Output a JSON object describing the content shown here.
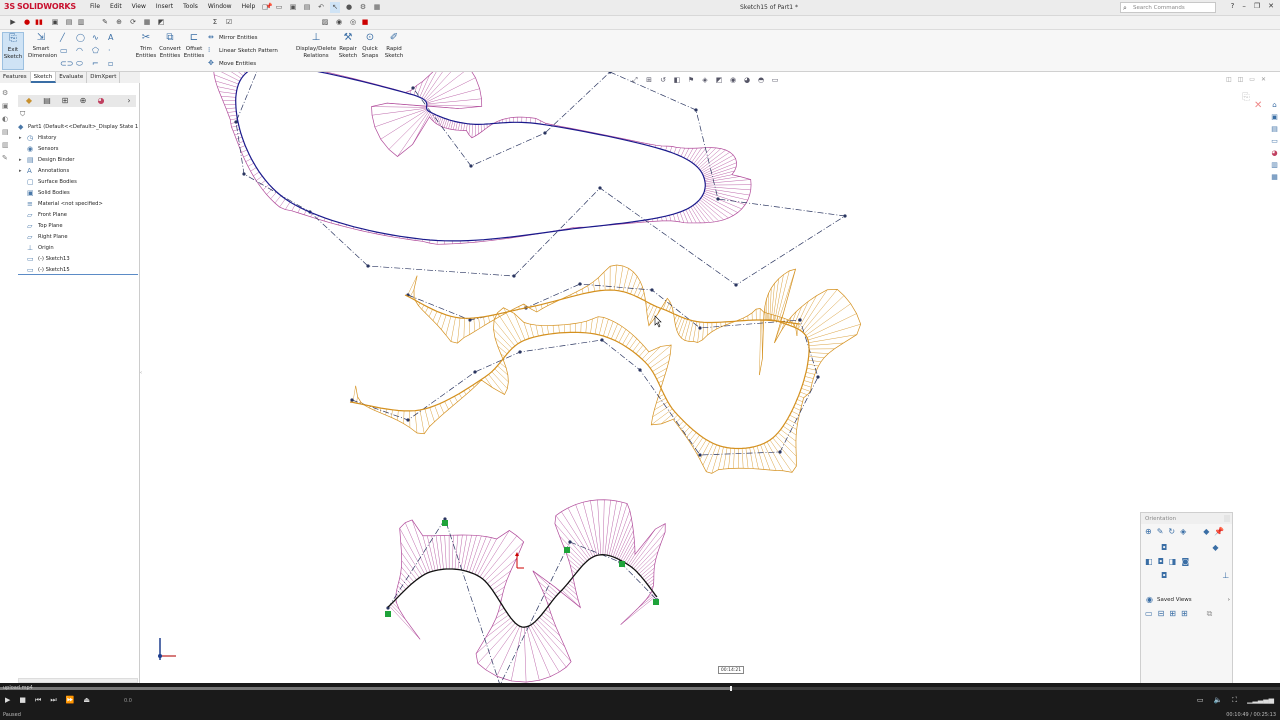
{
  "app": {
    "logo_text": "SOLIDWORKS",
    "document_title": "Sketch15 of Part1 *"
  },
  "menu": [
    "File",
    "Edit",
    "View",
    "Insert",
    "Tools",
    "Window",
    "Help"
  ],
  "search": {
    "placeholder": "Search Commands"
  },
  "ribbon": {
    "exit_sketch": "Exit Sketch",
    "smart_dimension": "Smart Dimension",
    "trim_entities": "Trim Entities",
    "convert_entities": "Convert Entities",
    "offset_entities": "Offset Entities",
    "mirror_entities": "Mirror Entities",
    "linear_sketch_pattern": "Linear Sketch Pattern",
    "move_entities": "Move Entities",
    "display_delete_relations": "Display/Delete Relations",
    "repair_sketch": "Repair Sketch",
    "quick_snaps": "Quick Snaps",
    "rapid_sketch": "Rapid Sketch"
  },
  "cm_tabs": [
    "Features",
    "Sketch",
    "Evaluate",
    "DimXpert"
  ],
  "cm_active_tab": "Sketch",
  "tree": [
    {
      "label": "Part1  (Default<<Default>_Display State 1",
      "icon": "part-icon",
      "root": true
    },
    {
      "label": "History",
      "icon": "history-icon",
      "arrow": true
    },
    {
      "label": "Sensors",
      "icon": "sensor-icon"
    },
    {
      "label": "Design Binder",
      "icon": "binder-icon",
      "arrow": true
    },
    {
      "label": "Annotations",
      "icon": "annotation-icon",
      "arrow": true
    },
    {
      "label": "Surface Bodies",
      "icon": "surface-body-icon"
    },
    {
      "label": "Solid Bodies",
      "icon": "solid-body-icon"
    },
    {
      "label": "Material <not specified>",
      "icon": "material-icon"
    },
    {
      "label": "Front Plane",
      "icon": "plane-icon"
    },
    {
      "label": "Top Plane",
      "icon": "plane-icon"
    },
    {
      "label": "Right Plane",
      "icon": "plane-icon"
    },
    {
      "label": "Origin",
      "icon": "origin-icon"
    },
    {
      "label": "(-) Sketch13",
      "icon": "sketch-icon"
    },
    {
      "label": "(-) Sketch15",
      "icon": "sketch-icon"
    }
  ],
  "orientation": {
    "title": "Orientation",
    "saved_views": "Saved Views"
  },
  "timeline_tooltip": "00:14:21",
  "player": {
    "file": "upload.mp4",
    "status": "Paused",
    "speed": "0.0",
    "time": "00:10:49 / 00:25:13",
    "progress": 0.57
  },
  "colors": {
    "accent": "#3a6ea5",
    "curve_blue": "#1a1a8c",
    "comb_magenta": "#b04a9a",
    "curve_orange": "#d4901e",
    "control_polygon": "#2a3560",
    "point_green": "#1fa33a"
  }
}
